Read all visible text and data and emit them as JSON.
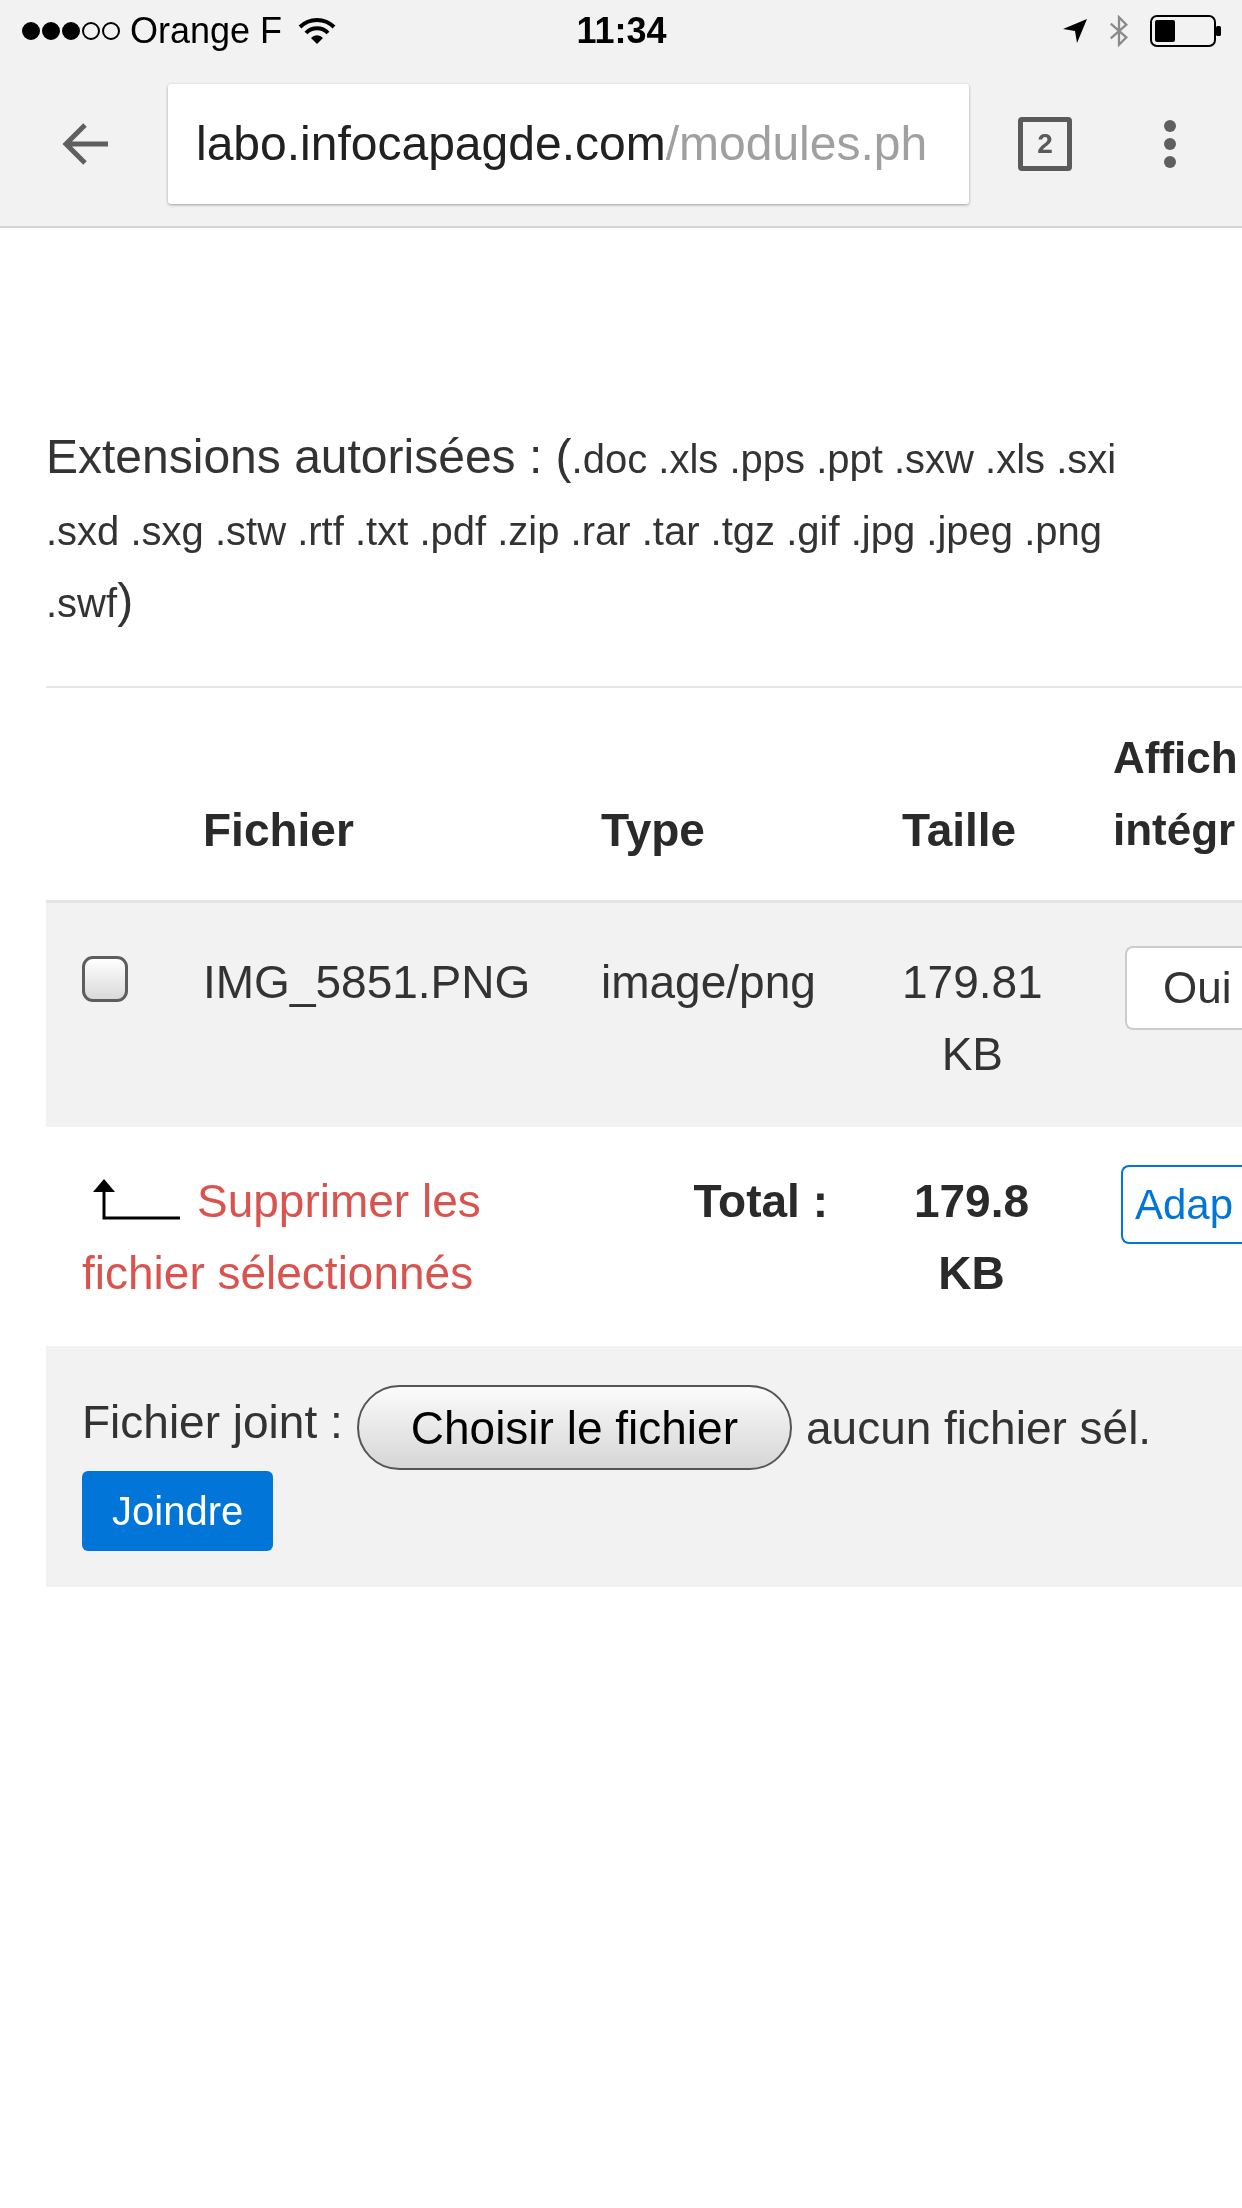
{
  "status_bar": {
    "carrier": "Orange F",
    "time": "11:34"
  },
  "browser": {
    "url": {
      "host": "labo.infocapagde.com",
      "path": "/modules.ph"
    },
    "tab_count": "2"
  },
  "extensions": {
    "label": "Extensions autorisées : (",
    "list": ".doc .xls .pps .ppt .sxw .xls .sxi .sxd .sxg .stw .rtf .txt .pdf .zip .rar .tar .tgz .gif .jpg .jpeg .png .swf",
    "closing": ")"
  },
  "table": {
    "columns": [
      "Fichier",
      "Type",
      "Taille",
      "Affich intégr"
    ],
    "rows": [
      {
        "checked": false,
        "file": "IMG_5851.PNG",
        "type": "image/png",
        "size": "179.81 KB",
        "display": "Oui"
      }
    ],
    "footer": {
      "delete_link": "Supprimer les fichier sélectionnés",
      "total_label": "Total :",
      "total_size": "179.8 KB",
      "option": "Adap"
    }
  },
  "attachment": {
    "label": "Fichier joint :",
    "choose_button": "Choisir le fichier",
    "file_status": "aucun fichier sél.",
    "submit_button": "Joindre"
  }
}
